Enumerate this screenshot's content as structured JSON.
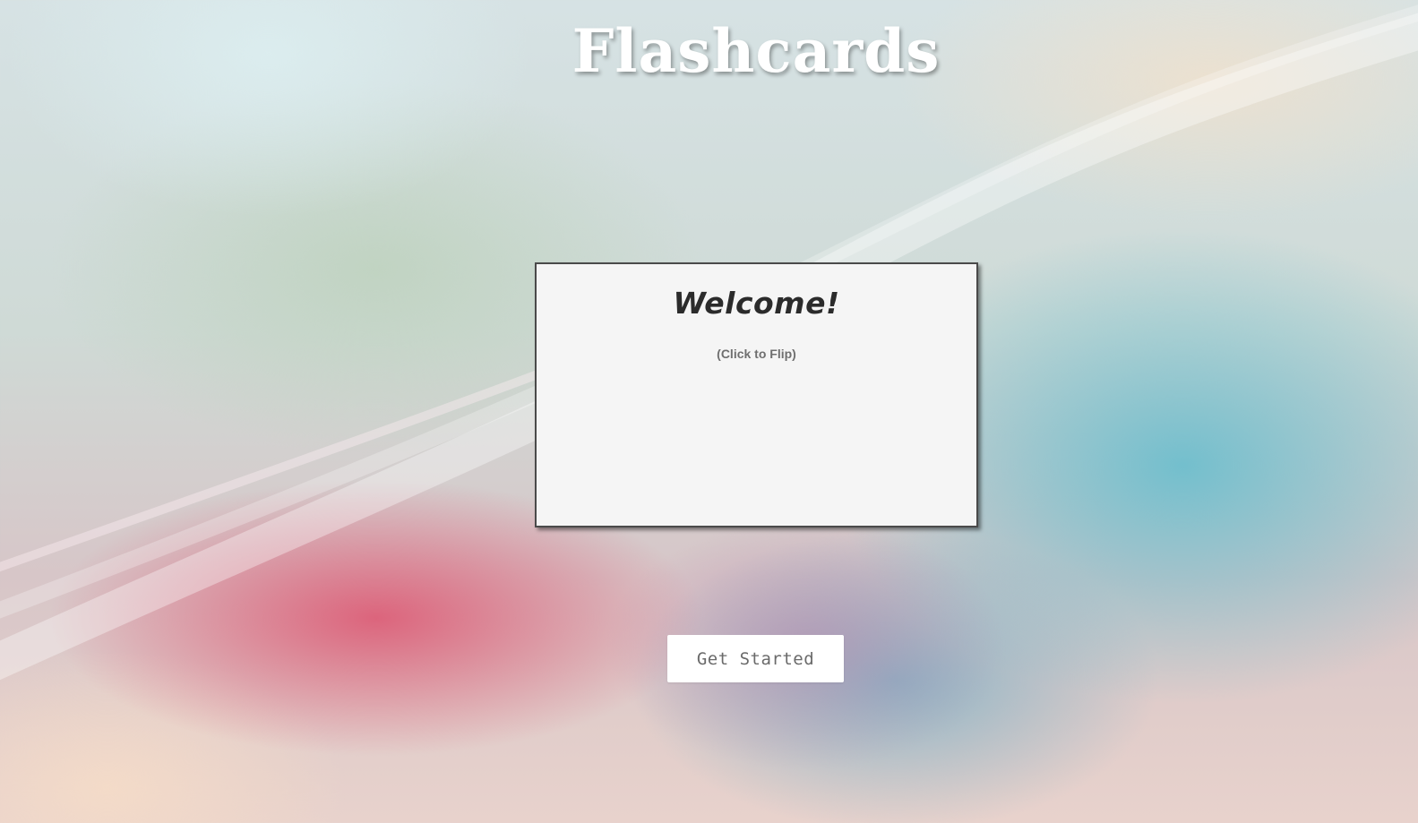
{
  "header": {
    "title": "Flashcards"
  },
  "card": {
    "heading": "Welcome!",
    "hint": "(Click to Flip)"
  },
  "actions": {
    "get_started_label": "Get Started"
  },
  "colors": {
    "title_text": "#ffffff",
    "card_background": "#f5f5f5",
    "card_border": "#4a4a4a",
    "button_background": "#ffffff",
    "button_text": "#6a6a6a"
  }
}
